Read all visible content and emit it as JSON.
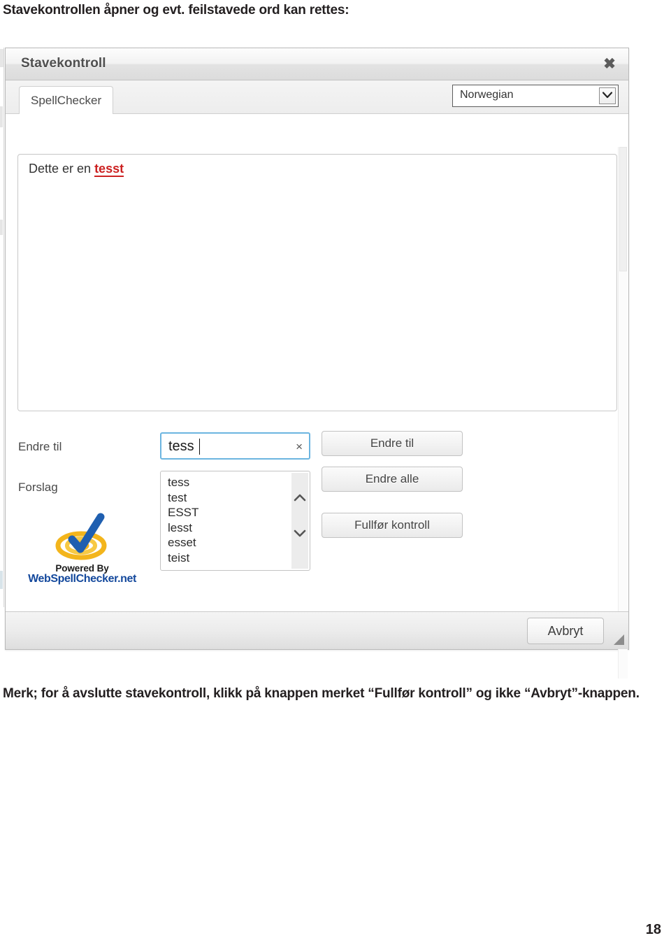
{
  "document": {
    "intro_text": "Stavekontrollen åpner og evt. feilstavede ord kan rettes:",
    "outro_text": "Merk; for å avslutte stavekontroll, klikk på knappen merket “Fullfør kontroll” og ikke “Avbryt”-knappen.",
    "page_number": "18"
  },
  "dialog": {
    "title": "Stavekontroll",
    "close_icon": "close-icon",
    "tab": {
      "label": "SpellChecker"
    },
    "language_select": {
      "value": "Norwegian",
      "arrow_icon": "chevron-down-icon"
    },
    "editor": {
      "text_before": "Dette er en ",
      "misspelled_word": "tesst"
    },
    "labels": {
      "change_to": "Endre til",
      "suggestions": "Forslag"
    },
    "replace_input": {
      "value": "tess",
      "clear_icon": "×"
    },
    "suggestions": [
      "tess",
      "test",
      "ESST",
      "lesst",
      "esset",
      "teist"
    ],
    "scrollbar": {
      "up_icon": "chevron-up-icon",
      "down_icon": "chevron-down-icon"
    },
    "buttons": {
      "change_to": "Endre til",
      "change_all": "Endre alle",
      "finish_check": "Fullfør kontroll",
      "cancel": "Avbryt"
    },
    "logo": {
      "powered_by": "Powered By",
      "brand": "WebSpellChecker.net",
      "mark_icon": "check-target-logo-icon"
    }
  },
  "colors": {
    "misspelled": "#cc2222",
    "input_focus": "#6cb5e0",
    "brand_blue": "#13489c",
    "logo_gold": "#f5b81e",
    "logo_check_blue": "#1f5fb0"
  }
}
